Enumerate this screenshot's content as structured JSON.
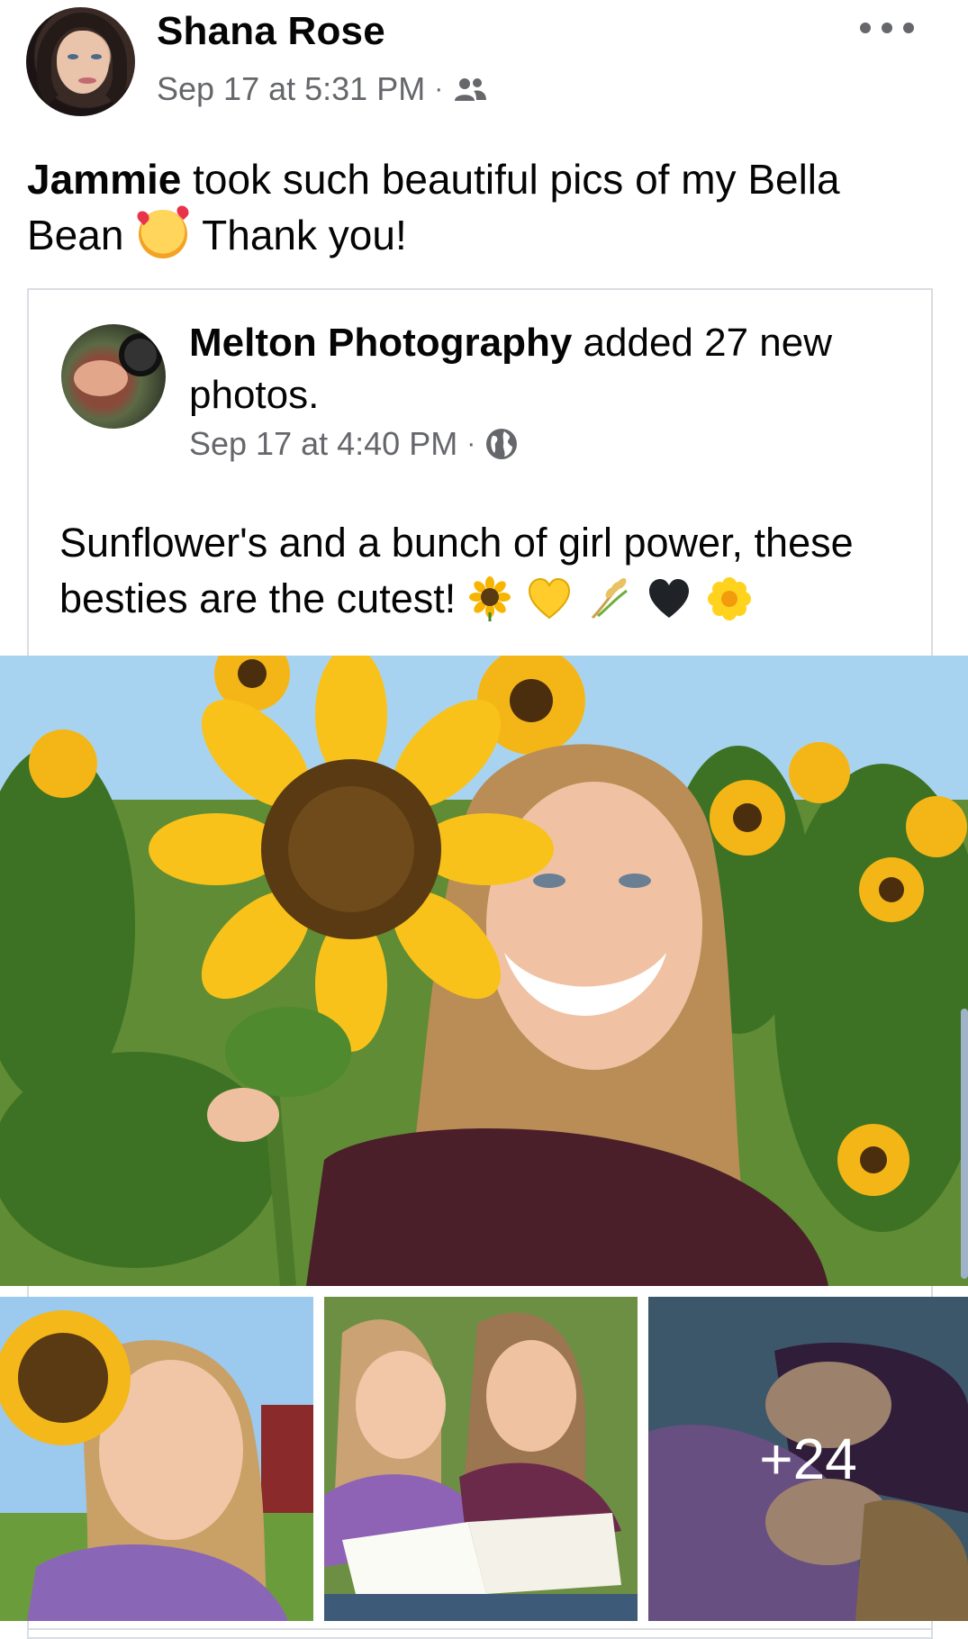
{
  "header": {
    "author_name": "Shana Rose",
    "timestamp": "Sep 17 at 5:31 PM",
    "separator": "·",
    "audience_icon": "friends-icon",
    "more_icon": "more-options-icon"
  },
  "post": {
    "mention": "Jammie",
    "text_before_emoji": " took such beautiful pics of my Bella Bean ",
    "emoji": "smiling-face-with-hearts",
    "text_after_emoji": " Thank you!"
  },
  "shared": {
    "page_name": "Melton Photography",
    "action": " added 27 new photos.",
    "timestamp": "Sep 17 at 4:40 PM",
    "separator": "·",
    "audience_icon": "globe-icon",
    "text": "Sunflower's and a bunch of girl power, these besties are the cutest!",
    "emojis": [
      "sunflower",
      "yellow-heart",
      "sheaf-of-rice",
      "black-heart",
      "blossom"
    ]
  },
  "photos": {
    "main_alt": "Girl smiling holding sunflower in sunflower field",
    "thumb_1_alt": "Girl behind sunflower",
    "thumb_2_alt": "Two girls reading books",
    "thumb_3_alt": "Two girls lying on blanket",
    "more_count": "+24"
  },
  "colors": {
    "text_primary": "#050505",
    "text_secondary": "#65676b",
    "border": "#dadde1"
  }
}
